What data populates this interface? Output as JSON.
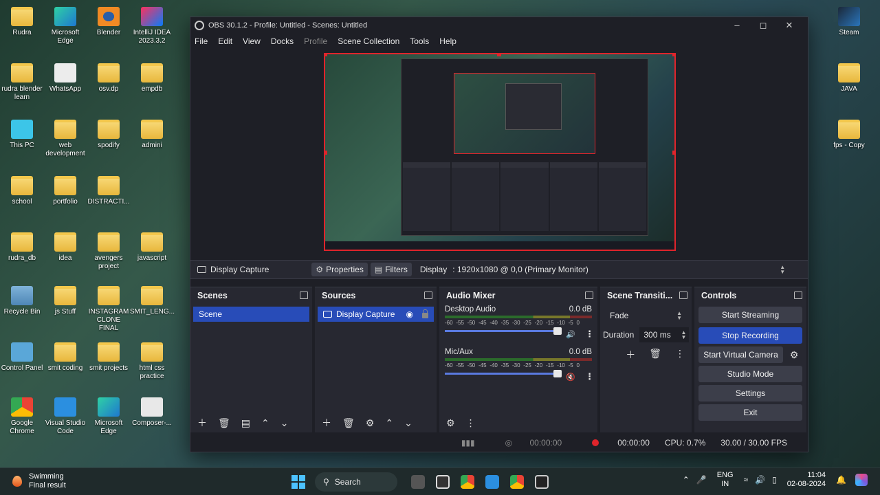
{
  "desktop": {
    "icons": [
      {
        "label": "Rudra",
        "type": "folder"
      },
      {
        "label": "Microsoft Edge",
        "type": "edge"
      },
      {
        "label": "Blender",
        "type": "blender"
      },
      {
        "label": "IntelliJ IDEA 2023.3.2",
        "type": "intellij"
      },
      {
        "label": "rudra blender learn",
        "type": "folder"
      },
      {
        "label": "WhatsApp",
        "type": "whatsapp"
      },
      {
        "label": "osv.dp",
        "type": "folder"
      },
      {
        "label": "empdb",
        "type": "folder"
      },
      {
        "label": "This PC",
        "type": "pc"
      },
      {
        "label": "web development",
        "type": "folder"
      },
      {
        "label": "spodify",
        "type": "folder"
      },
      {
        "label": "admini",
        "type": "folder"
      },
      {
        "label": "school",
        "type": "folder"
      },
      {
        "label": "portfolio",
        "type": "folder"
      },
      {
        "label": "DISTRACTI...",
        "type": "folder"
      },
      {
        "label": "rudra_db",
        "type": "folder"
      },
      {
        "label": "idea",
        "type": "folder"
      },
      {
        "label": "avengers project",
        "type": "folder"
      },
      {
        "label": "javascript",
        "type": "folder"
      },
      {
        "label": "Recycle Bin",
        "type": "bin"
      },
      {
        "label": "js Stuff",
        "type": "folder"
      },
      {
        "label": "INSTAGRAM CLONE FINAL",
        "type": "folder"
      },
      {
        "label": "SMIT_LENG...",
        "type": "folder"
      },
      {
        "label": "Control Panel",
        "type": "control"
      },
      {
        "label": "smit coding",
        "type": "folder"
      },
      {
        "label": "smit projects",
        "type": "folder"
      },
      {
        "label": "html css practice",
        "type": "folder"
      },
      {
        "label": "Google Chrome",
        "type": "chrome"
      },
      {
        "label": "Visual Studio Code",
        "type": "vscode"
      },
      {
        "label": "Microsoft Edge",
        "type": "edge"
      },
      {
        "label": "Composer-...",
        "type": "composer"
      },
      {
        "label": "Steam",
        "type": "steam"
      },
      {
        "label": "JAVA",
        "type": "folder"
      },
      {
        "label": "fps - Copy",
        "type": "folder"
      }
    ]
  },
  "obs": {
    "title": "OBS 30.1.2 - Profile: Untitled - Scenes: Untitled",
    "menu": [
      "File",
      "Edit",
      "View",
      "Docks",
      "Profile",
      "Scene Collection",
      "Tools",
      "Help"
    ],
    "source_bar": {
      "source_name": "Display Capture",
      "properties": "Properties",
      "filters": "Filters",
      "display_label": "Display",
      "display_value": ": 1920x1080 @ 0,0 (Primary Monitor)"
    },
    "scenes": {
      "title": "Scenes",
      "items": [
        "Scene"
      ]
    },
    "sources": {
      "title": "Sources",
      "items": [
        "Display Capture"
      ]
    },
    "mixer": {
      "title": "Audio Mixer",
      "scale": [
        "-60",
        "-55",
        "-50",
        "-45",
        "-40",
        "-35",
        "-30",
        "-25",
        "-20",
        "-15",
        "-10",
        "-5",
        "0"
      ],
      "channels": [
        {
          "name": "Desktop Audio",
          "level": "0.0 dB",
          "muted": false
        },
        {
          "name": "Mic/Aux",
          "level": "0.0 dB",
          "muted": true
        }
      ]
    },
    "transitions": {
      "title": "Scene Transiti...",
      "type": "Fade",
      "duration_label": "Duration",
      "duration_value": "300 ms"
    },
    "controls": {
      "title": "Controls",
      "start_streaming": "Start Streaming",
      "stop_recording": "Stop Recording",
      "start_virtual_camera": "Start Virtual Camera",
      "studio_mode": "Studio Mode",
      "settings": "Settings",
      "exit": "Exit"
    },
    "status": {
      "stream_time": "00:00:00",
      "rec_time": "00:00:00",
      "cpu": "CPU: 0.7%",
      "fps": "30.00 / 30.00 FPS"
    }
  },
  "taskbar": {
    "weather_title": "Swimming",
    "weather_sub": "Final result",
    "search": "Search",
    "lang_top": "ENG",
    "lang_bottom": "IN",
    "time": "11:04",
    "date": "02-08-2024"
  },
  "colors": {
    "accent": "#284cb8",
    "record": "#e0242b",
    "panel": "#272831",
    "window": "#1e1f26"
  }
}
